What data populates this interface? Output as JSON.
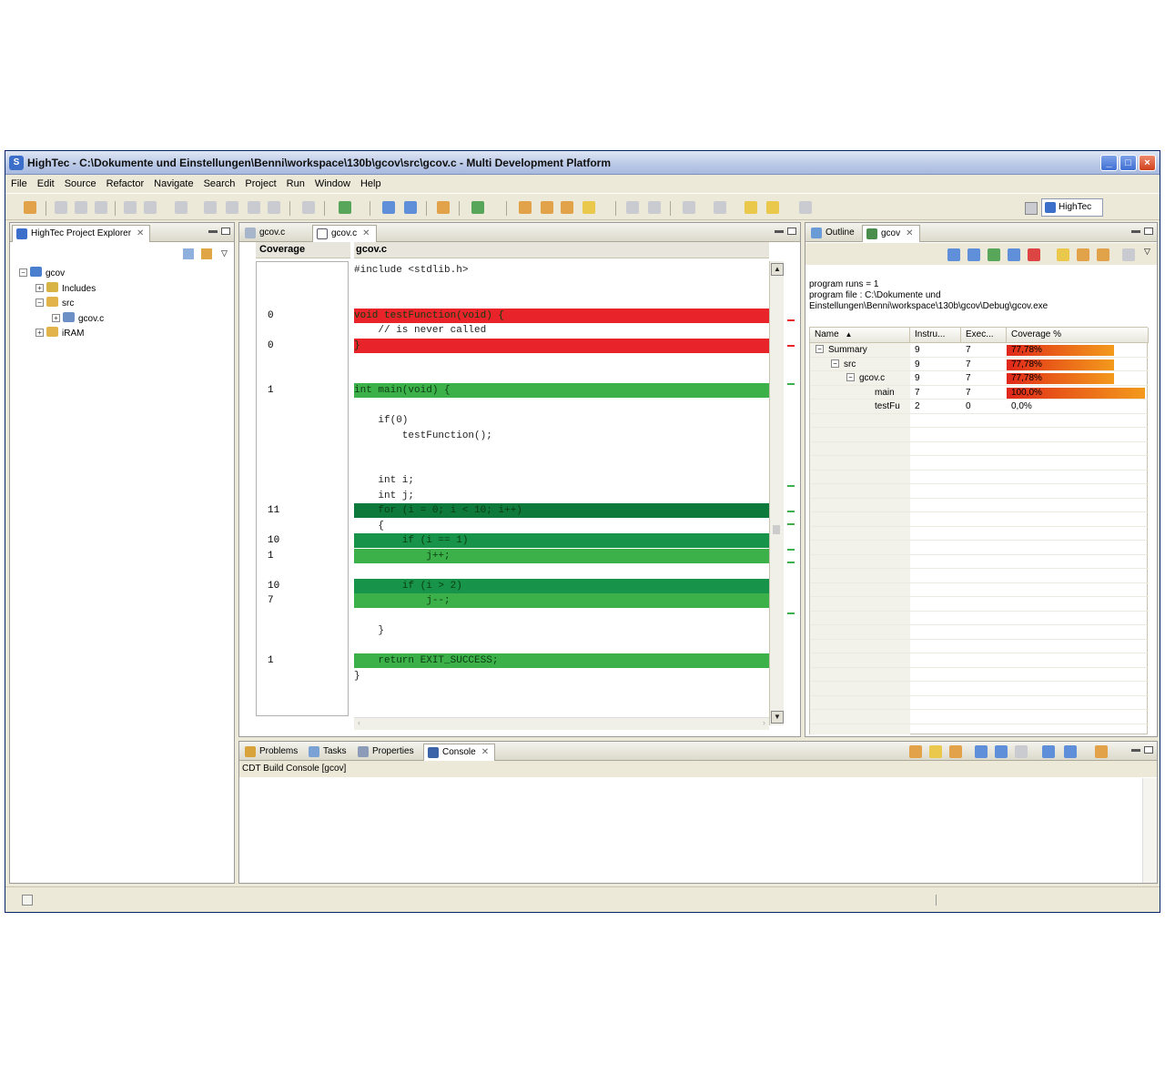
{
  "window": {
    "title": "HighTec - C:\\Dokumente und Einstellungen\\Benni\\workspace\\130b\\gcov\\src\\gcov.c - Multi Development Platform",
    "icon": "hightec-app-icon"
  },
  "menu": [
    "File",
    "Edit",
    "Source",
    "Refactor",
    "Navigate",
    "Search",
    "Project",
    "Run",
    "Window",
    "Help"
  ],
  "perspective": {
    "label": "HighTec"
  },
  "explorer": {
    "tab_label": "HighTec Project Explorer",
    "tree": [
      {
        "label": "gcov",
        "level": 0,
        "expander": "−",
        "icon_color": "#4a7fd0"
      },
      {
        "label": "Includes",
        "level": 1,
        "expander": "+",
        "icon_color": "#d8b447"
      },
      {
        "label": "src",
        "level": 1,
        "expander": "−",
        "icon_color": "#e2b34a"
      },
      {
        "label": "gcov.c",
        "level": 2,
        "expander": "+",
        "icon_color": "#6c8fc6"
      },
      {
        "label": "iRAM",
        "level": 1,
        "expander": "+",
        "icon_color": "#e2b34a"
      }
    ]
  },
  "editor": {
    "tabs": [
      {
        "label": "gcov.c",
        "active": false
      },
      {
        "label": "gcov.c",
        "active": true
      }
    ],
    "coverage_header": "Coverage",
    "file_header": "gcov.c",
    "lines": [
      {
        "count": "",
        "code": "#include <stdlib.h>",
        "hl": ""
      },
      {
        "count": "",
        "code": "",
        "hl": ""
      },
      {
        "count": "",
        "code": "",
        "hl": ""
      },
      {
        "count": "0",
        "code": "void testFunction(void) {",
        "hl": "red"
      },
      {
        "count": "",
        "code": "    // is never called",
        "hl": ""
      },
      {
        "count": "0",
        "code": "}",
        "hl": "red"
      },
      {
        "count": "",
        "code": "",
        "hl": ""
      },
      {
        "count": "",
        "code": "",
        "hl": ""
      },
      {
        "count": "1",
        "code": "int main(void) {",
        "hl": "green"
      },
      {
        "count": "",
        "code": "",
        "hl": ""
      },
      {
        "count": "",
        "code": "    if(0)",
        "hl": ""
      },
      {
        "count": "",
        "code": "        testFunction();",
        "hl": ""
      },
      {
        "count": "",
        "code": "",
        "hl": ""
      },
      {
        "count": "",
        "code": "",
        "hl": ""
      },
      {
        "count": "",
        "code": "    int i;",
        "hl": ""
      },
      {
        "count": "",
        "code": "    int j;",
        "hl": ""
      },
      {
        "count": "11",
        "code": "    for (i = 0; i < 10; i++)",
        "hl": "darkgreen"
      },
      {
        "count": "",
        "code": "    {",
        "hl": ""
      },
      {
        "count": "10",
        "code": "        if (i == 1)",
        "hl": "midgreen"
      },
      {
        "count": "1",
        "code": "            j++;",
        "hl": "green"
      },
      {
        "count": "",
        "code": "",
        "hl": ""
      },
      {
        "count": "10",
        "code": "        if (i > 2)",
        "hl": "midgreen"
      },
      {
        "count": "7",
        "code": "            j--;",
        "hl": "green"
      },
      {
        "count": "",
        "code": "",
        "hl": ""
      },
      {
        "count": "",
        "code": "    }",
        "hl": ""
      },
      {
        "count": "",
        "code": "",
        "hl": ""
      },
      {
        "count": "1",
        "code": "    return EXIT_SUCCESS;",
        "hl": "green"
      },
      {
        "count": "",
        "code": "}",
        "hl": ""
      }
    ]
  },
  "colors": {
    "red": "#e8232a",
    "green": "#3db149",
    "midgreen": "#17934a",
    "darkgreen": "#0d7a3c"
  },
  "gcov_view": {
    "tabs": [
      {
        "label": "Outline",
        "active": false
      },
      {
        "label": "gcov",
        "active": true
      }
    ],
    "info_runs": "program runs = 1",
    "info_file_1": "program file : C:\\Dokumente und",
    "info_file_2": "Einstellungen\\Benni\\workspace\\130b\\gcov\\Debug\\gcov.exe",
    "columns": [
      "Name",
      "Instru...",
      "Exec...",
      "Coverage %"
    ],
    "rows": [
      {
        "name": "Summary",
        "level": 0,
        "expander": "−",
        "instr": "9",
        "exec": "7",
        "cov": "77,78%",
        "pct": 77.78
      },
      {
        "name": "src",
        "level": 1,
        "expander": "−",
        "instr": "9",
        "exec": "7",
        "cov": "77,78%",
        "pct": 77.78
      },
      {
        "name": "gcov.c",
        "level": 2,
        "expander": "−",
        "instr": "9",
        "exec": "7",
        "cov": "77,78%",
        "pct": 77.78
      },
      {
        "name": "main",
        "level": 3,
        "expander": "",
        "instr": "7",
        "exec": "7",
        "cov": "100,0%",
        "pct": 100
      },
      {
        "name": "testFu",
        "level": 3,
        "expander": "",
        "instr": "2",
        "exec": "0",
        "cov": "0,0%",
        "pct": 0
      }
    ]
  },
  "bottom": {
    "tabs": [
      {
        "label": "Problems",
        "active": false
      },
      {
        "label": "Tasks",
        "active": false
      },
      {
        "label": "Properties",
        "active": false
      },
      {
        "label": "Console",
        "active": true
      }
    ],
    "console_title": "CDT Build Console [gcov]"
  }
}
